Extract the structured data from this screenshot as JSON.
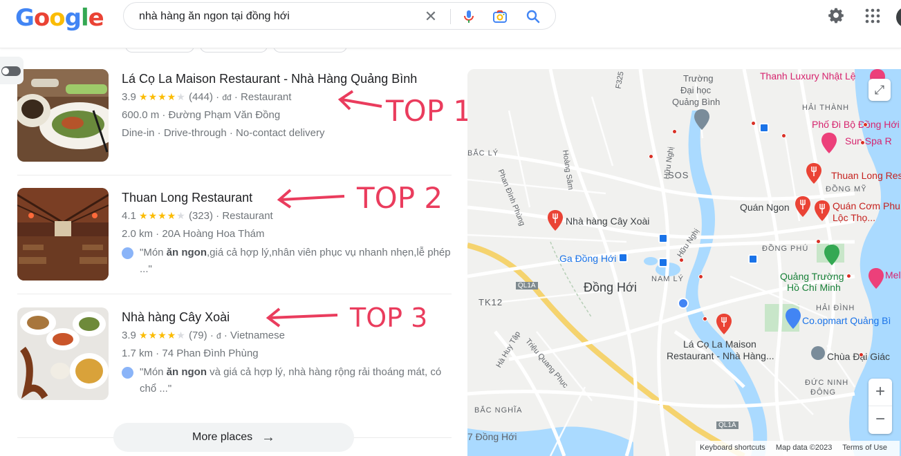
{
  "header": {
    "logo_letters": [
      {
        "ch": "G",
        "color": "#4285f4"
      },
      {
        "ch": "o",
        "color": "#ea4335"
      },
      {
        "ch": "o",
        "color": "#fbbc05"
      },
      {
        "ch": "g",
        "color": "#4285f4"
      },
      {
        "ch": "l",
        "color": "#34a853"
      },
      {
        "ch": "e",
        "color": "#ea4335"
      }
    ],
    "search_query": "nhà hàng ăn ngon tại đồng hới",
    "clear_symbol": "✕"
  },
  "results": [
    {
      "name": "Lá Cọ La Maison Restaurant - Nhà Hàng Quảng Bình",
      "rating": "3.9",
      "stars": 4,
      "reviews": "(444)",
      "price": "đđ",
      "category": "Restaurant",
      "distance": "600.0 m",
      "address": "Đường Phạm Văn Đồng",
      "services": "Dine-in · Drive-through · No-contact delivery",
      "annotation": "TOP 1"
    },
    {
      "name": "Thuan Long Restaurant",
      "rating": "4.1",
      "stars": 4,
      "reviews": "(323)",
      "category": "Restaurant",
      "distance": "2.0 km",
      "address": "20A Hoàng Hoa Thám",
      "quote_pre": "\"Món ",
      "quote_bold": "ăn ngon",
      "quote_post": ",giá cả hợp lý,nhân viên phục vụ nhanh nhẹn,lễ phép ...\"",
      "annotation": "TOP 2"
    },
    {
      "name": "Nhà hàng Cây Xoài",
      "rating": "3.9",
      "stars": 4,
      "reviews": "(79)",
      "price": "đ",
      "category": "Vietnamese",
      "distance": "1.7 km",
      "address": "74 Phan Đình Phùng",
      "quote_pre": "\"Món ",
      "quote_bold": "ăn ngon",
      "quote_post": " và giá cả hợp lý, nhà hàng rộng rải thoáng mát, có chổ ...\"",
      "annotation": "TOP 3"
    }
  ],
  "more_places": "More places",
  "map": {
    "labels": {
      "thanh_luxury": "Thanh Luxury Nhật Lệ",
      "truong": "Trường",
      "dai_hoc": "Đại học",
      "quang_binh": "Quảng Bình",
      "hai_thanh": "HẢI THÀNH",
      "pho_di_bo": "Phố Đi Bộ Đồng Hới",
      "sun_spa": "Sun Spa R",
      "f325": "F325",
      "bac_ly": "BẮC LÝ",
      "hoang_sam": "Hoàng Sâm",
      "huu_nghi_1": "Hữu Nghị",
      "sos": "SOS",
      "thuan_long": "Thuan Long Rest",
      "dong_my": "ĐỒNG MỸ",
      "quan_ngon": "Quán Ngon",
      "quan_com_phu": "Quán Cơm Phu",
      "loc_tho": "Lộc Thọ...",
      "phan_dinh_phung": "Phan Đình Phùng",
      "cay_xoai": "Nhà hàng Cây Xoài",
      "huu_nghi_2": "Hữu Nghị",
      "dong_phu": "ĐỒNG PHÚ",
      "ga_dong_hoi": "Ga Đồng Hới",
      "nam_ly": "NAM LÝ",
      "quang_truong": "Quảng Trường",
      "ho_chi_minh": "Hồ Chí Minh",
      "mel": "Mel",
      "ql1a_1": "QL1A",
      "dong_hoi": "Đồng Hới",
      "tk12": "TK12",
      "hai_dinh": "HẢI ĐÌNH",
      "coopmart": "Co.opmart Quảng Bì",
      "la_co_1": "Lá Cọ La Maison",
      "la_co_2": "Restaurant - Nhà Hàng...",
      "ha_huy_tap": "Hà Huy Tập",
      "trieu_quang_phuc": "Triệu Quang Phục",
      "chua_dai_giac": "Chùa Đại Giác",
      "duc_ninh": "ĐỨC NINH",
      "dong": "ĐÔNG",
      "bac_nghia": "BẮC NGHĨA",
      "ql1a_2": "QL1A",
      "dong_hoi_2": "7 Đồng Hới"
    },
    "zoom_in": "+",
    "zoom_out": "−",
    "expand_symbol": "⤢",
    "attribution": {
      "shortcuts": "Keyboard shortcuts",
      "map_data": "Map data ©2023",
      "terms": "Terms of Use"
    }
  }
}
